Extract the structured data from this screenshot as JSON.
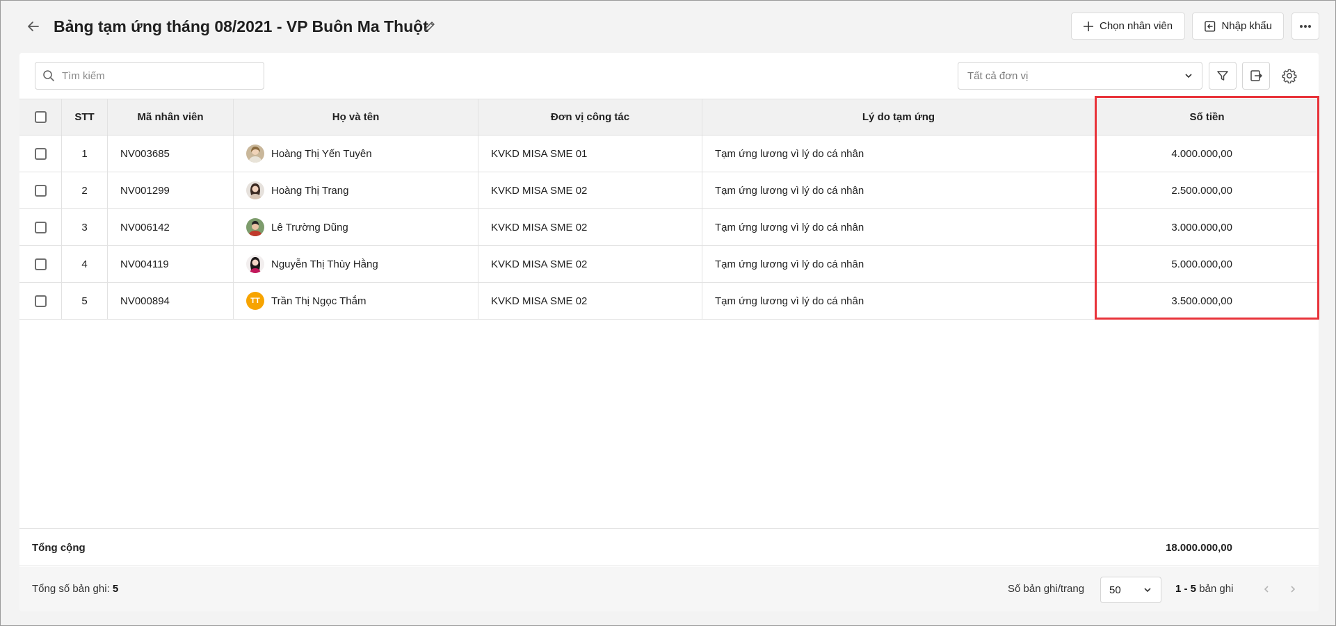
{
  "header": {
    "title": "Bảng tạm ứng tháng 08/2021 - VP Buôn Ma Thuột",
    "choose_employee_label": "Chọn nhân viên",
    "import_label": "Nhập khẩu"
  },
  "toolbar": {
    "search_placeholder": "Tìm kiếm",
    "unit_filter_value": "Tất cả đơn vị"
  },
  "table": {
    "columns": {
      "stt": "STT",
      "code": "Mã nhân viên",
      "name": "Họ và tên",
      "unit": "Đơn vị công tác",
      "reason": "Lý do tạm ứng",
      "amount": "Số tiền"
    },
    "rows": [
      {
        "stt": "1",
        "code": "NV003685",
        "name": "Hoàng Thị Yến Tuyên",
        "unit": "KVKD MISA SME 01",
        "reason": "Tạm ứng lương vì lý do cá nhân",
        "amount": "4.000.000,00",
        "avatar": "photo"
      },
      {
        "stt": "2",
        "code": "NV001299",
        "name": "Hoàng Thị Trang",
        "unit": "KVKD MISA SME 02",
        "reason": "Tạm ứng lương vì lý do cá nhân",
        "amount": "2.500.000,00",
        "avatar": "photo"
      },
      {
        "stt": "3",
        "code": "NV006142",
        "name": "Lê Trường Dũng",
        "unit": "KVKD MISA SME 02",
        "reason": "Tạm ứng lương vì lý do cá nhân",
        "amount": "3.000.000,00",
        "avatar": "photo"
      },
      {
        "stt": "4",
        "code": "NV004119",
        "name": "Nguyễn Thị Thùy Hằng",
        "unit": "KVKD MISA SME 02",
        "reason": "Tạm ứng lương vì lý do cá nhân",
        "amount": "5.000.000,00",
        "avatar": "photo"
      },
      {
        "stt": "5",
        "code": "NV000894",
        "name": "Trần Thị Ngọc Thắm",
        "unit": "KVKD MISA SME 02",
        "reason": "Tạm ứng lương vì lý do cá nhân",
        "amount": "3.500.000,00",
        "avatar": "TT"
      }
    ]
  },
  "totals": {
    "label": "Tổng cộng",
    "amount": "18.000.000,00"
  },
  "footer": {
    "total_records_label": "Tổng số bản ghi:",
    "total_records_value": "5",
    "per_page_label": "Số bản ghi/trang",
    "per_page_value": "50",
    "range_value": "1 - 5",
    "range_suffix": "bản ghi"
  },
  "colors": {
    "highlight": "#e8333a",
    "initials_avatar": "#f7a400"
  },
  "icons": [
    "back-arrow-icon",
    "pencil-icon",
    "plus-icon",
    "import-icon",
    "more-icon",
    "search-icon",
    "chevron-down-icon",
    "filter-icon",
    "export-icon",
    "gear-icon",
    "chevron-left-icon",
    "chevron-right-icon"
  ]
}
